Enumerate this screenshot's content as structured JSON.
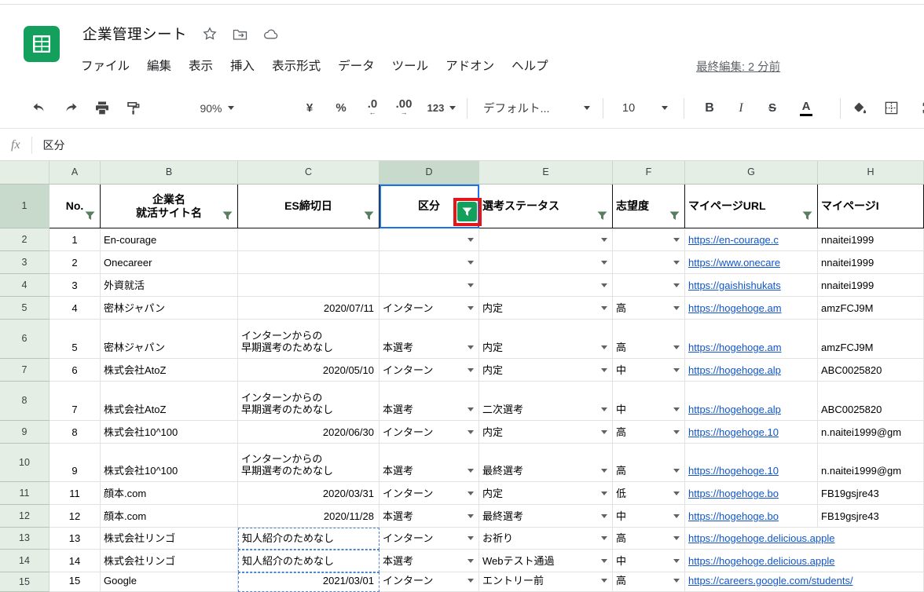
{
  "titlebar": {
    "title": "企業管理シート",
    "last_edited": "最終編集: 2 分前",
    "menus": [
      "ファイル",
      "編集",
      "表示",
      "挿入",
      "表示形式",
      "データ",
      "ツール",
      "アドオン",
      "ヘルプ"
    ]
  },
  "toolbar": {
    "zoom": "90%",
    "currency": "¥",
    "percent": "%",
    "decrease_decimals": ".0",
    "decrease_arrow": "←",
    "increase_decimals": ".00",
    "increase_arrow": "→",
    "more_formats": "123",
    "font_name": "デフォルト...",
    "font_size": "10",
    "bold": "B",
    "italic": "I",
    "strikethrough": "S",
    "text_color": "A"
  },
  "formula_bar": {
    "fx_label": "fx",
    "value": "区分"
  },
  "sheet": {
    "column_letters": [
      "A",
      "B",
      "C",
      "D",
      "E",
      "F",
      "G",
      "H"
    ],
    "active_column": "D",
    "active_row": "1",
    "headers": [
      {
        "col": "A",
        "label": "No.",
        "filter": true,
        "highlighted": false
      },
      {
        "col": "B",
        "label": "企業名\n就活サイト名",
        "filter": true,
        "highlighted": false
      },
      {
        "col": "C",
        "label": "ES締切日",
        "filter": true,
        "highlighted": false
      },
      {
        "col": "D",
        "label": "区分",
        "filter": true,
        "highlighted": true
      },
      {
        "col": "E",
        "label": "選考ステータス",
        "filter": true,
        "highlighted": false
      },
      {
        "col": "F",
        "label": "志望度",
        "filter": true,
        "highlighted": false
      },
      {
        "col": "G",
        "label": "マイページURL",
        "filter": true,
        "highlighted": false
      },
      {
        "col": "H",
        "label": "マイページI",
        "filter": false,
        "highlighted": false
      }
    ],
    "rows": [
      {
        "row": 2,
        "no": "1",
        "company": "En-courage",
        "es_deadline": "",
        "category": "",
        "status": "",
        "priority": "",
        "url": "https://en-courage.c",
        "page_id": "nnaitei1999"
      },
      {
        "row": 3,
        "no": "2",
        "company": "Onecareer",
        "es_deadline": "",
        "category": "",
        "status": "",
        "priority": "",
        "url": "https://www.onecare",
        "page_id": "nnaitei1999"
      },
      {
        "row": 4,
        "no": "3",
        "company": "外資就活",
        "es_deadline": "",
        "category": "",
        "status": "",
        "priority": "",
        "url": "https://gaishishukats",
        "page_id": "nnaitei1999"
      },
      {
        "row": 5,
        "no": "4",
        "company": "密林ジャパン",
        "es_deadline": "2020/07/11",
        "category": "インターン",
        "status": "内定",
        "priority": "高",
        "url": "https://hogehoge.am",
        "page_id": "amzFCJ9M"
      },
      {
        "row": 6,
        "no": "5",
        "company": "密林ジャパン",
        "es_deadline": "インターンからの\n早期選考のためなし",
        "category": "本選考",
        "status": "内定",
        "priority": "高",
        "url": "https://hogehoge.am",
        "page_id": "amzFCJ9M"
      },
      {
        "row": 7,
        "no": "6",
        "company": "株式会社AtoZ",
        "es_deadline": "2020/05/10",
        "category": "インターン",
        "status": "内定",
        "priority": "中",
        "url": "https://hogehoge.alp",
        "page_id": "ABC0025820"
      },
      {
        "row": 8,
        "no": "7",
        "company": "株式会社AtoZ",
        "es_deadline": "インターンからの\n早期選考のためなし",
        "category": "本選考",
        "status": "二次選考",
        "priority": "中",
        "url": "https://hogehoge.alp",
        "page_id": "ABC0025820"
      },
      {
        "row": 9,
        "no": "8",
        "company": "株式会社10^100",
        "es_deadline": "2020/06/30",
        "category": "インターン",
        "status": "内定",
        "priority": "高",
        "url": "https://hogehoge.10",
        "page_id": "n.naitei1999@gm"
      },
      {
        "row": 10,
        "no": "9",
        "company": "株式会社10^100",
        "es_deadline": "インターンからの\n早期選考のためなし",
        "category": "本選考",
        "status": "最終選考",
        "priority": "高",
        "url": "https://hogehoge.10",
        "page_id": "n.naitei1999@gm"
      },
      {
        "row": 11,
        "no": "11",
        "company": "顔本.com",
        "es_deadline": "2020/03/31",
        "category": "インターン",
        "status": "内定",
        "priority": "低",
        "url": "https://hogehoge.bo",
        "page_id": "FB19gsjre43"
      },
      {
        "row": 12,
        "no": "12",
        "company": "顔本.com",
        "es_deadline": "2020/11/28",
        "category": "本選考",
        "status": "最終選考",
        "priority": "中",
        "url": "https://hogehoge.bo",
        "page_id": "FB19gsjre43"
      },
      {
        "row": 13,
        "no": "13",
        "company": "株式会社リンゴ",
        "es_deadline": "知人紹介のためなし",
        "category": "インターン",
        "status": "お祈り",
        "priority": "高",
        "url": "https://hogehoge.delicious.apple",
        "page_id": ""
      },
      {
        "row": 14,
        "no": "14",
        "company": "株式会社リンゴ",
        "es_deadline": "知人紹介のためなし",
        "category": "本選考",
        "status": "Webテスト通過",
        "priority": "中",
        "url": "https://hogehoge.delicious.apple",
        "page_id": ""
      },
      {
        "row": 15,
        "no": "15",
        "company": "Google",
        "es_deadline": "2021/03/01",
        "category": "インターン",
        "status": "エントリー前",
        "priority": "高",
        "url": "https://careers.google.com/students/",
        "page_id": ""
      }
    ]
  },
  "colors": {
    "sheets_green": "#12A05C",
    "link_blue": "#1155CC",
    "selection_blue": "#1A73E8",
    "annotation_red": "#E3171A",
    "filter_header_tint": "#E4EEE5",
    "selected_header_tint": "#C7DACB"
  }
}
